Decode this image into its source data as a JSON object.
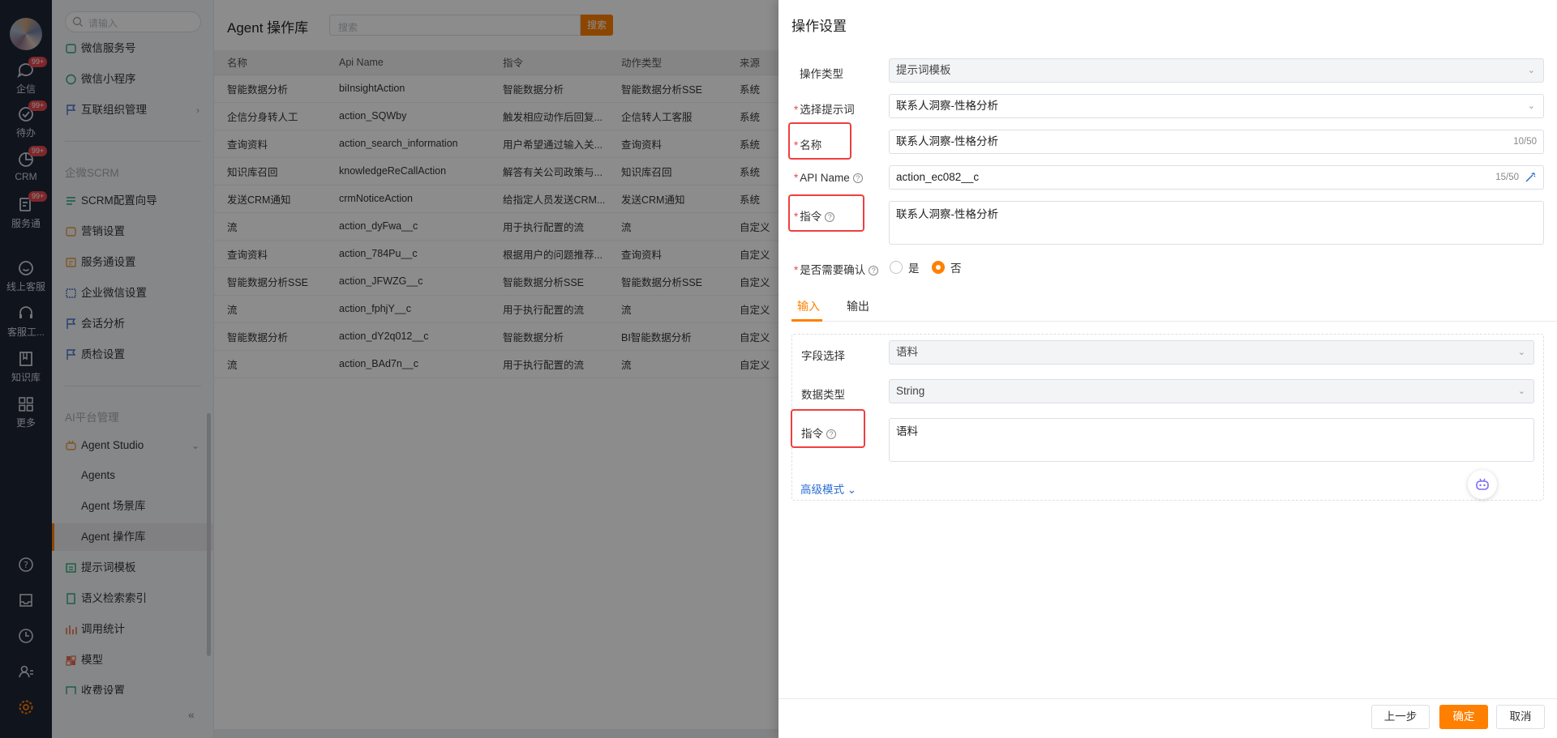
{
  "rail": {
    "items": [
      {
        "label": "企信",
        "badge": "99+",
        "icon": "chat-icon"
      },
      {
        "label": "待办",
        "badge": "99+",
        "icon": "check-circle-icon"
      },
      {
        "label": "CRM",
        "badge": "99+",
        "icon": "pie-icon"
      },
      {
        "label": "服务通",
        "badge": "99+",
        "icon": "service-icon"
      },
      {
        "label": "线上客服",
        "icon": "smile-chat-icon"
      },
      {
        "label": "客服工...",
        "icon": "headset-icon"
      },
      {
        "label": "知识库",
        "icon": "book-icon"
      },
      {
        "label": "更多",
        "icon": "grid-icon"
      }
    ],
    "bottom_icons": [
      "help-icon",
      "inbox-icon",
      "clock-icon",
      "user-list-icon",
      "settings-icon"
    ]
  },
  "menu": {
    "search_placeholder": "请输入",
    "items_top": [
      {
        "label": "微信服务号",
        "icon": "wechat-service-icon"
      },
      {
        "label": "微信小程序",
        "icon": "mini-program-icon"
      },
      {
        "label": "互联组织管理",
        "icon": "flag-icon",
        "arrow": "›"
      }
    ],
    "section_scrm": "企微SCRM",
    "items_scrm": [
      {
        "label": "SCRM配置向导",
        "icon": "guide-icon"
      },
      {
        "label": "营销设置",
        "icon": "marketing-icon"
      },
      {
        "label": "服务通设置",
        "icon": "service-setting-icon"
      },
      {
        "label": "企业微信设置",
        "icon": "wecom-icon"
      },
      {
        "label": "会话分析",
        "icon": "flag-icon"
      },
      {
        "label": "质检设置",
        "icon": "flag-icon"
      }
    ],
    "section_ai": "AI平台管理",
    "agent_studio": {
      "label": "Agent Studio",
      "icon": "robot-icon",
      "arrow": "⌄"
    },
    "agent_sub": [
      "Agents",
      "Agent 场景库",
      "Agent 操作库"
    ],
    "items_ai": [
      {
        "label": "提示词模板",
        "icon": "template-icon"
      },
      {
        "label": "语义检索索引",
        "icon": "index-icon"
      },
      {
        "label": "调用统计",
        "icon": "stats-icon"
      },
      {
        "label": "模型",
        "icon": "model-icon"
      },
      {
        "label": "收费设置",
        "icon": "billing-icon"
      }
    ],
    "collapse": "«"
  },
  "main": {
    "title": "Agent 操作库",
    "search_placeholder": "搜索",
    "search_button": "搜索",
    "columns": [
      "名称",
      "Api Name",
      "指令",
      "动作类型",
      "来源"
    ],
    "rows": [
      [
        "智能数据分析",
        "biInsightAction",
        "智能数据分析",
        "智能数据分析SSE",
        "系统"
      ],
      [
        "企信分身转人工",
        "action_SQWby",
        "触发相应动作后回复...",
        "企信转人工客服",
        "系统"
      ],
      [
        "查询资料",
        "action_search_information",
        "用户希望通过输入关...",
        "查询资料",
        "系统"
      ],
      [
        "知识库召回",
        "knowledgeReCallAction",
        "解答有关公司政策与...",
        "知识库召回",
        "系统"
      ],
      [
        "发送CRM通知",
        "crmNoticeAction",
        "给指定人员发送CRM...",
        "发送CRM通知",
        "系统"
      ],
      [
        "流",
        "action_dyFwa__c",
        "用于执行配置的流",
        "流",
        "自定义"
      ],
      [
        "查询资料",
        "action_784Pu__c",
        "根据用户的问题推荐...",
        "查询资料",
        "自定义"
      ],
      [
        "智能数据分析SSE",
        "action_JFWZG__c",
        "智能数据分析SSE",
        "智能数据分析SSE",
        "自定义"
      ],
      [
        "流",
        "action_fphjY__c",
        "用于执行配置的流",
        "流",
        "自定义"
      ],
      [
        "智能数据分析",
        "action_dY2q012__c",
        "智能数据分析",
        "BI智能数据分析",
        "自定义"
      ],
      [
        "流",
        "action_BAd7n__c",
        "用于执行配置的流",
        "流",
        "自定义"
      ]
    ]
  },
  "drawer": {
    "title": "操作设置",
    "fields": {
      "op_type": {
        "label": "操作类型",
        "value": "提示词模板"
      },
      "prompt": {
        "label": "选择提示词",
        "value": "联系人洞察-性格分析"
      },
      "name": {
        "label": "名称",
        "value": "联系人洞察-性格分析",
        "count": "10/50"
      },
      "api": {
        "label": "API Name",
        "value": "action_ec082__c",
        "count": "15/50"
      },
      "instr": {
        "label": "指令",
        "value": "联系人洞察-性格分析"
      },
      "confirm": {
        "label": "是否需要确认",
        "yes": "是",
        "no": "否",
        "selected": "否"
      }
    },
    "tabs": [
      "输入",
      "输出"
    ],
    "active_tab": "输入",
    "input": {
      "field_select": {
        "label": "字段选择",
        "value": "语料"
      },
      "data_type": {
        "label": "数据类型",
        "value": "String"
      },
      "instr": {
        "label": "指令",
        "value": "语料"
      }
    },
    "advanced": "高级模式",
    "buttons": {
      "prev": "上一步",
      "ok": "确定",
      "cancel": "取消"
    }
  },
  "colors": {
    "accent": "#ff8000",
    "highlight": "#ef3f3f",
    "link": "#2c6fd1",
    "rail": "#1e2535"
  }
}
